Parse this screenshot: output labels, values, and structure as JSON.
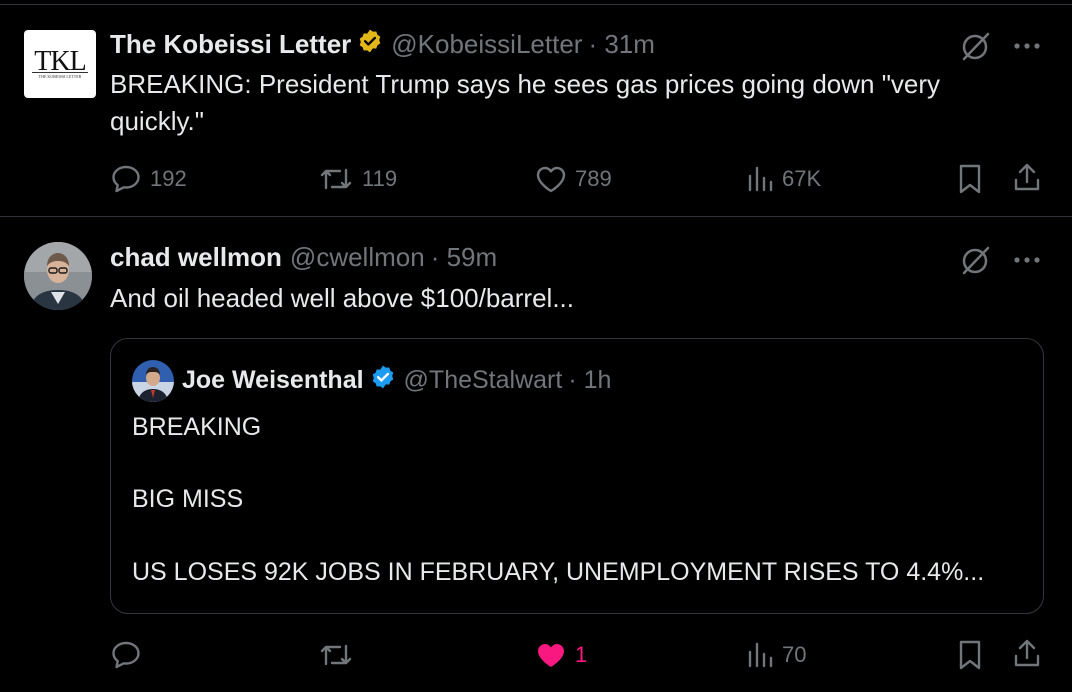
{
  "tweets": [
    {
      "name": "The Kobeissi Letter",
      "handle": "@KobeissiLetter",
      "time": "· 31m",
      "avatar_text": "TKL",
      "avatar_subtext": "THE KOBEISSI LETTER",
      "badge_color": "#e2b719",
      "text": "BREAKING: President Trump says he sees gas prices going down \"very quickly.\"",
      "replies": "192",
      "reposts": "119",
      "likes": "789",
      "views": "67K"
    },
    {
      "name": "chad wellmon",
      "handle": "@cwellmon",
      "time": "· 59m",
      "text": "And oil headed well above $100/barrel...",
      "replies": "",
      "reposts": "",
      "likes": "1",
      "views": "70",
      "like_color": "#f91880",
      "quote": {
        "name": "Joe Weisenthal",
        "handle": "@TheStalwart",
        "time": "· 1h",
        "badge_color": "#1d9bf0",
        "lines": [
          "BREAKING",
          "BIG MISS",
          "US LOSES 92K JOBS IN FEBRUARY, UNEMPLOYMENT RISES TO 4.4%..."
        ]
      }
    }
  ],
  "icons": [
    "reply-icon",
    "repost-icon",
    "like-icon",
    "views-icon",
    "bookmark-icon",
    "share-icon",
    "grok-icon",
    "more-icon",
    "verified-badge-icon"
  ]
}
